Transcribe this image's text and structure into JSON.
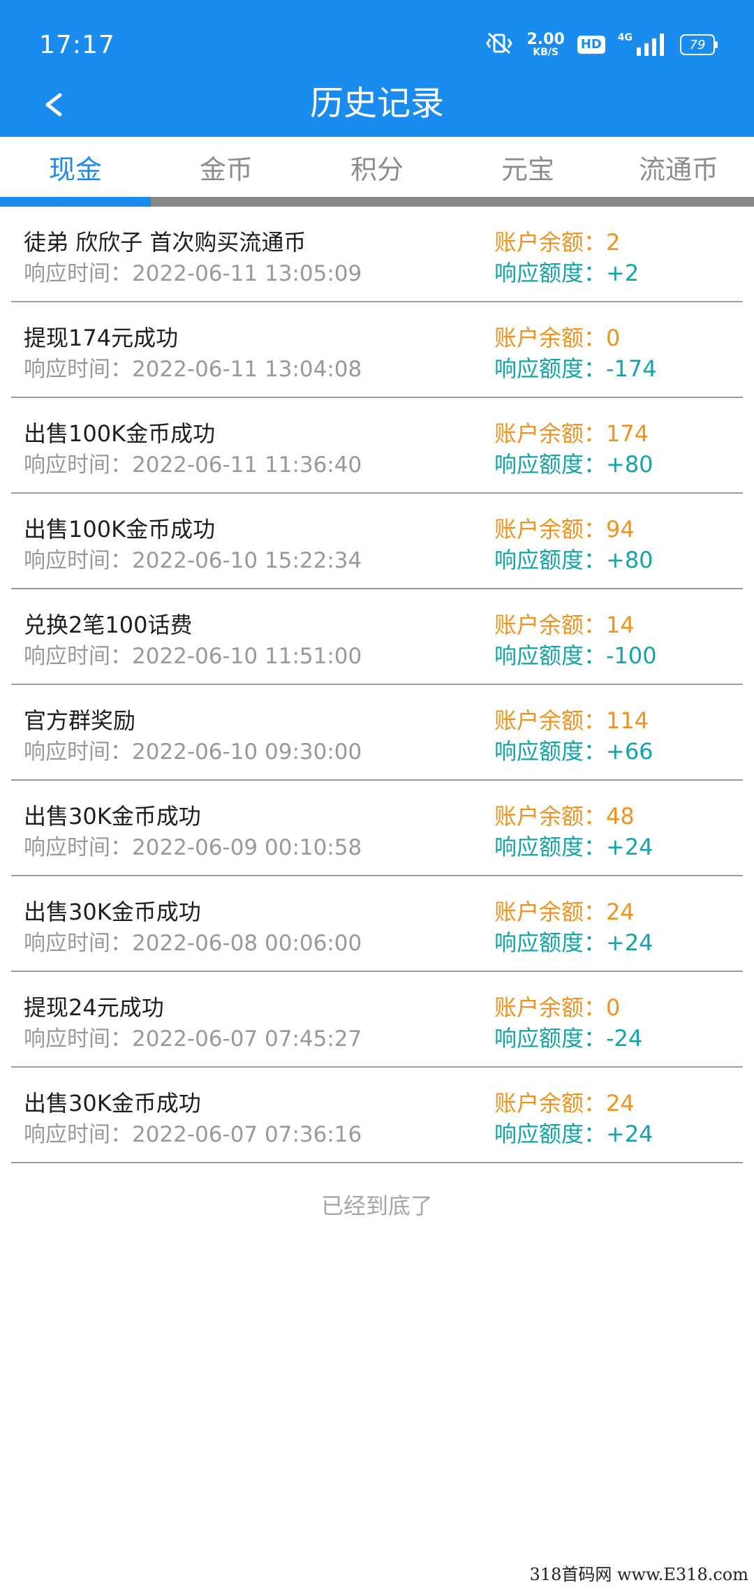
{
  "status_bar": {
    "time": "17:17",
    "net_speed_value": "2.00",
    "net_speed_unit": "KB/S",
    "hd_label": "HD",
    "network_label": "4G",
    "battery_level": "79",
    "icons": [
      "vibrate-mute-icon",
      "hd-icon",
      "signal-icon",
      "battery-icon"
    ]
  },
  "header": {
    "back_label": "<",
    "title": "历史记录"
  },
  "tabs": [
    {
      "label": "现金",
      "active": true
    },
    {
      "label": "金币",
      "active": false
    },
    {
      "label": "积分",
      "active": false
    },
    {
      "label": "元宝",
      "active": false
    },
    {
      "label": "流通币",
      "active": false
    }
  ],
  "records": [
    {
      "title": "徒弟 欣欣子 首次购买流通币",
      "time": "响应时间：2022-06-11 13:05:09",
      "balance": "账户余额：2",
      "amount": "响应额度：+2"
    },
    {
      "title": "提现174元成功",
      "time": "响应时间：2022-06-11 13:04:08",
      "balance": "账户余额：0",
      "amount": "响应额度：-174"
    },
    {
      "title": "出售100K金币成功",
      "time": "响应时间：2022-06-11 11:36:40",
      "balance": "账户余额：174",
      "amount": "响应额度：+80"
    },
    {
      "title": "出售100K金币成功",
      "time": "响应时间：2022-06-10 15:22:34",
      "balance": "账户余额：94",
      "amount": "响应额度：+80"
    },
    {
      "title": "兑换2笔100话费",
      "time": "响应时间：2022-06-10 11:51:00",
      "balance": "账户余额：14",
      "amount": "响应额度：-100"
    },
    {
      "title": "官方群奖励",
      "time": "响应时间：2022-06-10 09:30:00",
      "balance": "账户余额：114",
      "amount": "响应额度：+66"
    },
    {
      "title": "出售30K金币成功",
      "time": "响应时间：2022-06-09 00:10:58",
      "balance": "账户余额：48",
      "amount": "响应额度：+24"
    },
    {
      "title": "出售30K金币成功",
      "time": "响应时间：2022-06-08 00:06:00",
      "balance": "账户余额：24",
      "amount": "响应额度：+24"
    },
    {
      "title": "提现24元成功",
      "time": "响应时间：2022-06-07 07:45:27",
      "balance": "账户余额：0",
      "amount": "响应额度：-24"
    },
    {
      "title": "出售30K金币成功",
      "time": "响应时间：2022-06-07 07:36:16",
      "balance": "账户余额：24",
      "amount": "响应额度：+24"
    }
  ],
  "end_text": "已经到底了",
  "watermark": "318首码网 www.E318.com",
  "colors": {
    "primary": "#1a8cf0",
    "balance": "#f0931e",
    "amount": "#13a3a8",
    "muted": "#999999"
  }
}
